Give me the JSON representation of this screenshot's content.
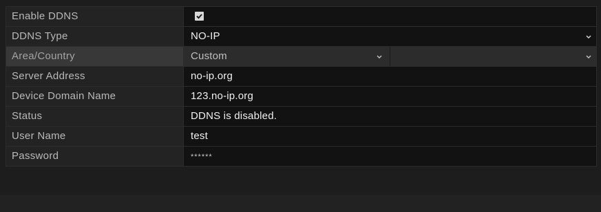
{
  "ddns_form": {
    "rows": [
      {
        "label": "Enable DDNS",
        "type": "checkbox",
        "checked": true
      },
      {
        "label": "DDNS Type",
        "type": "select",
        "value": "NO-IP"
      },
      {
        "label": "Area/Country",
        "type": "dual-select",
        "value": "Custom",
        "secondary_value": "",
        "disabled": true
      },
      {
        "label": "Server Address",
        "type": "text",
        "value": "no-ip.org"
      },
      {
        "label": "Device Domain Name",
        "type": "text",
        "value": "123.no-ip.org"
      },
      {
        "label": "Status",
        "type": "text",
        "value": "DDNS is disabled."
      },
      {
        "label": "User Name",
        "type": "text",
        "value": "test"
      },
      {
        "label": "Password",
        "type": "password",
        "value": "******"
      }
    ]
  },
  "colors": {
    "label_bg": "#232323",
    "value_bg": "#121212",
    "disabled_bg": "#383838",
    "text_primary": "#f0f0f0",
    "text_label": "#b9b9b9"
  },
  "icons": {
    "checkbox": "check-icon",
    "dropdown": "chevron-down-icon"
  }
}
